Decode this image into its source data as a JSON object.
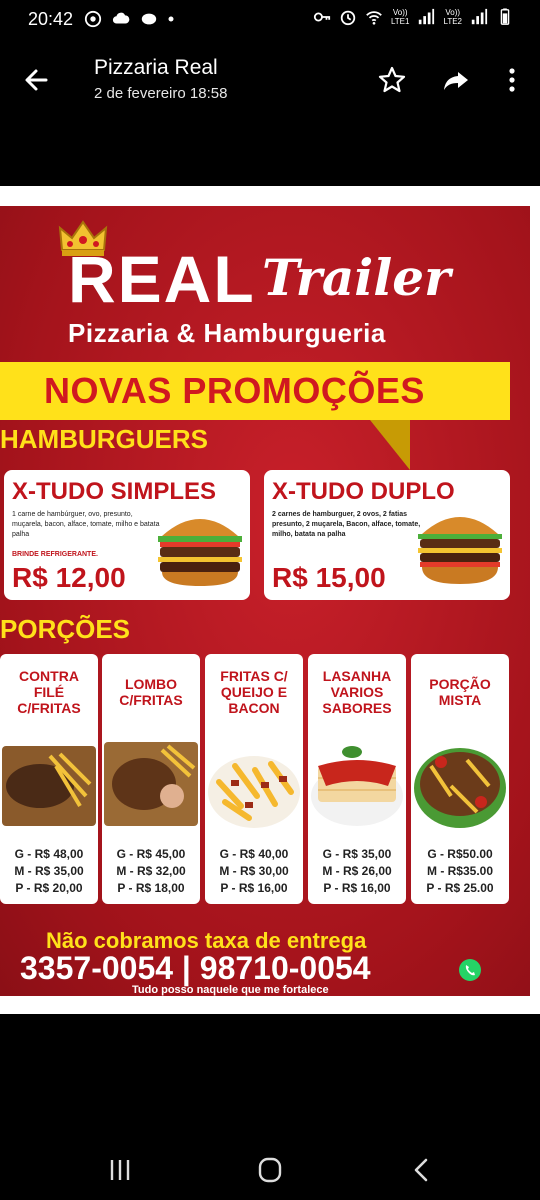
{
  "status": {
    "time": "20:42",
    "lte1": "Vo))\nLTE1",
    "lte2": "Vo))\nLTE2"
  },
  "header": {
    "title": "Pizzaria Real",
    "subtitle": "2 de fevereiro 18:58",
    "icons": [
      "back-arrow-icon",
      "star-icon",
      "share-icon",
      "more-vert-icon"
    ]
  },
  "flyer": {
    "brand_real": "REAL",
    "brand_trailer": "Trailer",
    "brand_sub": "Pizzaria & Hamburgueria",
    "promo": "NOVAS PROMOÇÕES",
    "burgers_heading": "HAMBURGUERS",
    "burgers": [
      {
        "name": "X-TUDO SIMPLES",
        "desc": "1 carne de hambúrguer, ovo, presunto, muçarela, bacon, alface, tomate, milho e batata palha",
        "gift": "BRINDE REFRIGERANTE.",
        "price": "R$ 12,00"
      },
      {
        "name": "X-TUDO DUPLO",
        "desc": "2 carnes de hamburguer, 2 ovos, 2 fatias presunto, 2 muçarela, Bacon, alface, tomate, milho, batata na palha",
        "gift": "",
        "price": "R$ 15,00"
      }
    ],
    "portions_heading": "PORÇÕES",
    "portions": [
      {
        "name": "CONTRA\nFILÉ\nC/FRITAS",
        "g": "G - R$ 48,00",
        "m": "M - R$ 35,00",
        "p": "P - R$ 20,00"
      },
      {
        "name": "LOMBO\nC/FRITAS",
        "g": "G - R$ 45,00",
        "m": "M - R$ 32,00",
        "p": "P - R$ 18,00"
      },
      {
        "name": "FRITAS C/\nQUEIJO E\nBACON",
        "g": "G - R$ 40,00",
        "m": "M - R$ 30,00",
        "p": "P - R$ 16,00"
      },
      {
        "name": "LASANHA\nVARIOS\nSABORES",
        "g": "G - R$ 35,00",
        "m": "M - R$ 26,00",
        "p": "P - R$ 16,00"
      },
      {
        "name": "PORÇÃO\nMISTA",
        "g": "G - R$50.00",
        "m": "M - R$35.00",
        "p": "P - R$ 25.00"
      }
    ],
    "delivery_note": "Não cobramos taxa de entrega",
    "phones": "3357-0054 | 98710-0054",
    "slogan": "Tudo posso naquele que me fortalece"
  },
  "nav": {
    "icons": [
      "recent-apps-icon",
      "home-icon",
      "back-icon"
    ]
  },
  "colors": {
    "flyer_red": "#a3131b",
    "accent_yellow": "#ffe11a",
    "price_red": "#c0141c"
  }
}
